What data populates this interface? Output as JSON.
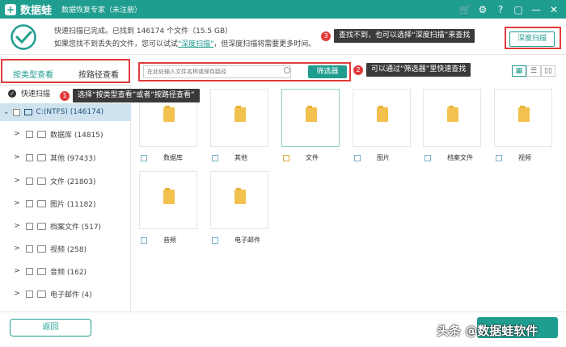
{
  "titlebar": {
    "logo_glyph": "+",
    "app_name": "数据蛙",
    "subtitle": "数据恢复专家（未注册）",
    "controls": [
      "🛒",
      "⚙",
      "?",
      "▢",
      "—",
      "✕"
    ]
  },
  "summary": {
    "line1": "快速扫描已完成。已找到 146174 个文件（15.5 GB）",
    "line2_prefix": "如果您找不到丢失的文件，您可以试试",
    "line2_link": "\"深度扫描\"",
    "line2_suffix": "，但深度扫描将需要更多时间。",
    "deep_scan_button": "深度扫描"
  },
  "callouts": {
    "tip1": {
      "num": "1",
      "text": "选择“按类型查看”或者“按路径查看”"
    },
    "tip2": {
      "num": "2",
      "text": "可以通过“筛选器”里快速查找"
    },
    "tip3": {
      "num": "3",
      "text": "查找不到，也可以选择“深度扫描”来查找"
    }
  },
  "tabs": {
    "by_type": "按类型查看",
    "by_path": "按路径查看"
  },
  "sidebar": {
    "quick_scan": "快速扫描",
    "drive": "C:(NTFS) (146174)",
    "items": [
      {
        "label": "数据库 (14815)"
      },
      {
        "label": "其他 (97433)"
      },
      {
        "label": "文件 (21803)"
      },
      {
        "label": "图片 (11182)"
      },
      {
        "label": "档案文件 (517)"
      },
      {
        "label": "视频 (258)"
      },
      {
        "label": "音频 (162)"
      },
      {
        "label": "电子邮件 (4)"
      }
    ]
  },
  "filter": {
    "placeholder": "在此处输入文件名称或保存路径",
    "button": "筛选器"
  },
  "view_switch": [
    "▦",
    "☰",
    "▯▯"
  ],
  "tiles": [
    {
      "label": "数据库"
    },
    {
      "label": "其他"
    },
    {
      "label": "文件"
    },
    {
      "label": "图片"
    },
    {
      "label": "档案文件"
    },
    {
      "label": "视频"
    },
    {
      "label": "音频"
    },
    {
      "label": "电子邮件"
    }
  ],
  "bottom": {
    "back_button": "返回",
    "watermark": "头条 @数据蛙软件"
  },
  "colors": {
    "accent": "#1f9d8f",
    "callout": "#e23b3b"
  }
}
